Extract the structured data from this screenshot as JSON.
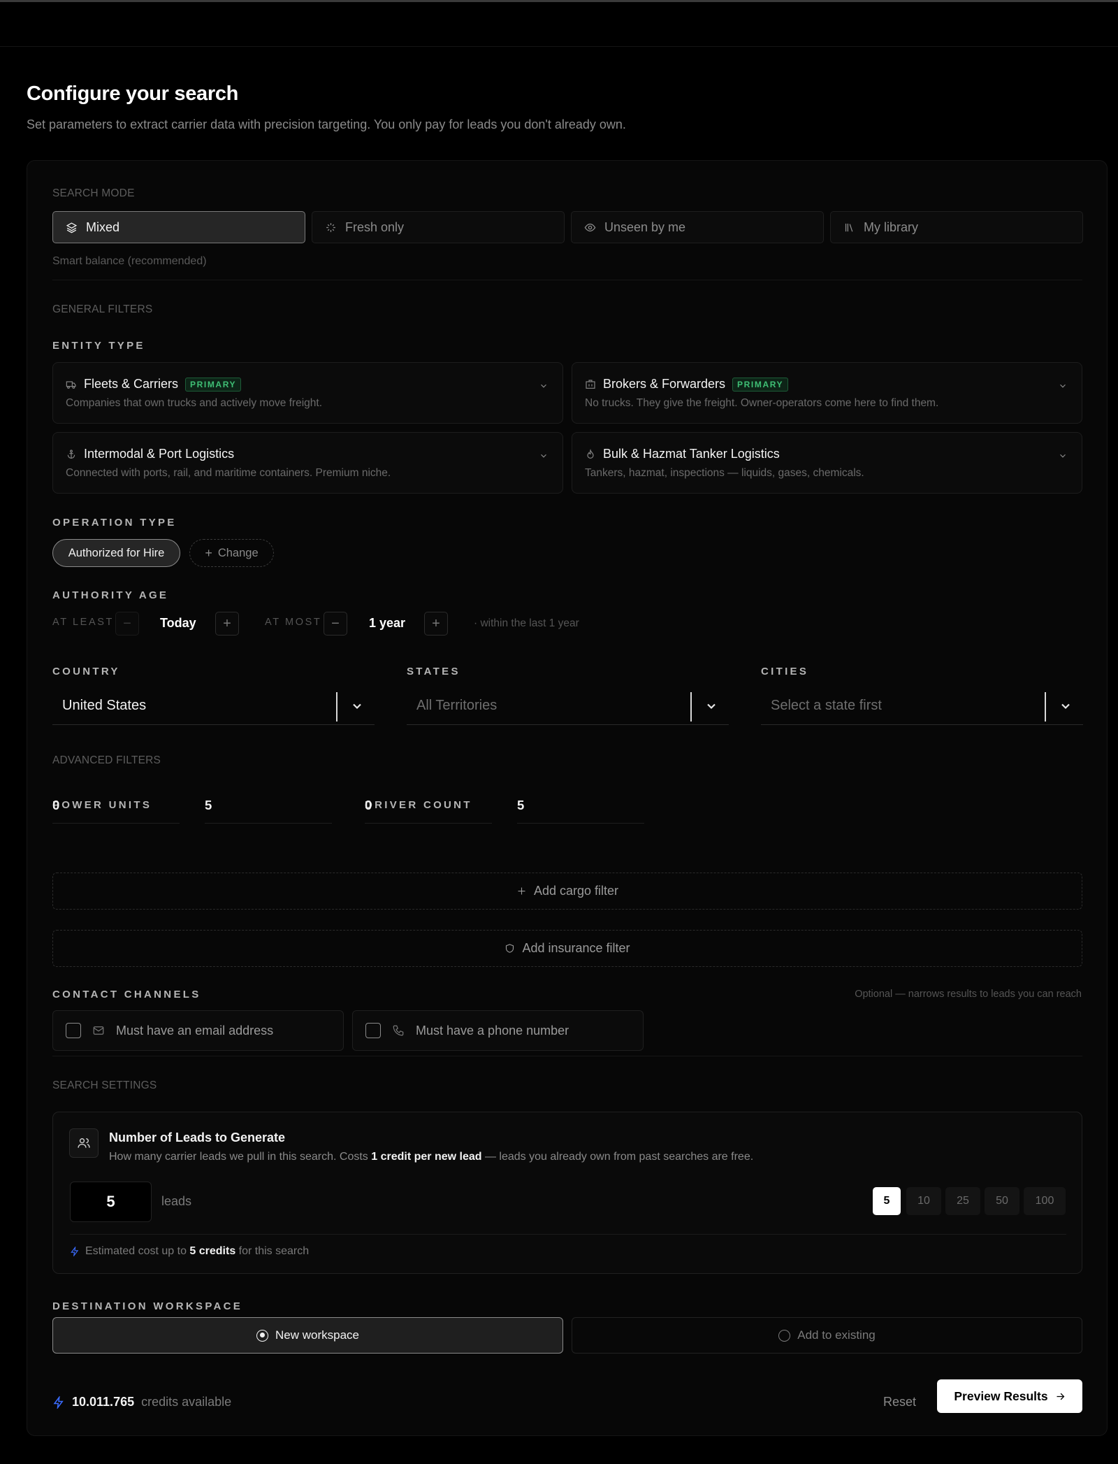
{
  "header": {
    "title": "Configure your search",
    "subtitle": "Set parameters to extract carrier data with precision targeting. You only pay for leads you don't already own."
  },
  "search_mode": {
    "label": "SEARCH MODE",
    "options": [
      {
        "label": "Mixed",
        "icon": "layers-icon",
        "active": true
      },
      {
        "label": "Fresh only",
        "icon": "sparkle-icon",
        "active": false
      },
      {
        "label": "Unseen by me",
        "icon": "eye-icon",
        "active": false
      },
      {
        "label": "My library",
        "icon": "library-icon",
        "active": false
      }
    ],
    "hint": "Smart balance (recommended)"
  },
  "general_filters": {
    "label": "GENERAL FILTERS",
    "entity_type": {
      "label": "ENTITY TYPE",
      "items": [
        {
          "name": "Fleets & Carriers",
          "badge": "PRIMARY",
          "desc": "Companies that own trucks and actively move freight.",
          "icon": "truck-icon"
        },
        {
          "name": "Brokers & Forwarders",
          "badge": "PRIMARY",
          "desc": "No trucks. They give the freight. Owner-operators come here to find them.",
          "icon": "building-icon"
        },
        {
          "name": "Intermodal & Port Logistics",
          "badge": "",
          "desc": "Connected with ports, rail, and maritime containers. Premium niche.",
          "icon": "anchor-icon"
        },
        {
          "name": "Bulk & Hazmat Tanker Logistics",
          "badge": "",
          "desc": "Tankers, hazmat, inspections — liquids, gases, chemicals.",
          "icon": "flame-icon"
        }
      ]
    },
    "operation_type": {
      "label": "OPERATION TYPE",
      "selected": "Authorized for Hire",
      "change_label": "Change"
    },
    "authority_age": {
      "label": "AUTHORITY AGE",
      "at_least_label": "AT LEAST",
      "at_least_value": "Today",
      "at_most_label": "AT MOST",
      "at_most_value": "1 year",
      "note": "· within the last 1 year"
    },
    "location": {
      "country_label": "COUNTRY",
      "country_value": "United States",
      "states_label": "STATES",
      "states_placeholder": "All Territories",
      "cities_label": "CITIES",
      "cities_placeholder": "Select a state first"
    }
  },
  "advanced_filters": {
    "label": "ADVANCED FILTERS",
    "power_units": {
      "label": "POWER UNITS",
      "min": "0",
      "max": "5"
    },
    "driver_count": {
      "label": "DRIVER COUNT",
      "min": "0",
      "max": "5"
    },
    "add_cargo": "Add cargo filter",
    "add_insurance": "Add insurance filter",
    "contact_channels": {
      "label": "CONTACT CHANNELS",
      "note": "Optional — narrows results to leads you can reach",
      "email": "Must have an email address",
      "phone": "Must have a phone number"
    }
  },
  "search_settings": {
    "label": "SEARCH SETTINGS",
    "leads": {
      "title": "Number of Leads to Generate",
      "desc_a": "How many carrier leads we pull in this search. Costs ",
      "desc_b": "1 credit per new lead",
      "desc_c": " — leads you already own from past searches are free.",
      "value": "5",
      "unit": "leads",
      "presets": [
        "5",
        "10",
        "25",
        "50",
        "100"
      ],
      "est_a": "Estimated cost up to ",
      "est_b": "5 credits",
      "est_c": " for this search"
    },
    "destination": {
      "label": "DESTINATION WORKSPACE",
      "new": "New workspace",
      "existing": "Add to existing"
    }
  },
  "footer": {
    "credits_value": "10.011.765",
    "credits_suffix": "credits available",
    "reset": "Reset",
    "preview": "Preview Results"
  },
  "colors": {
    "accent_blue": "#3b6cff",
    "primary_badge": "#3fbf75"
  }
}
